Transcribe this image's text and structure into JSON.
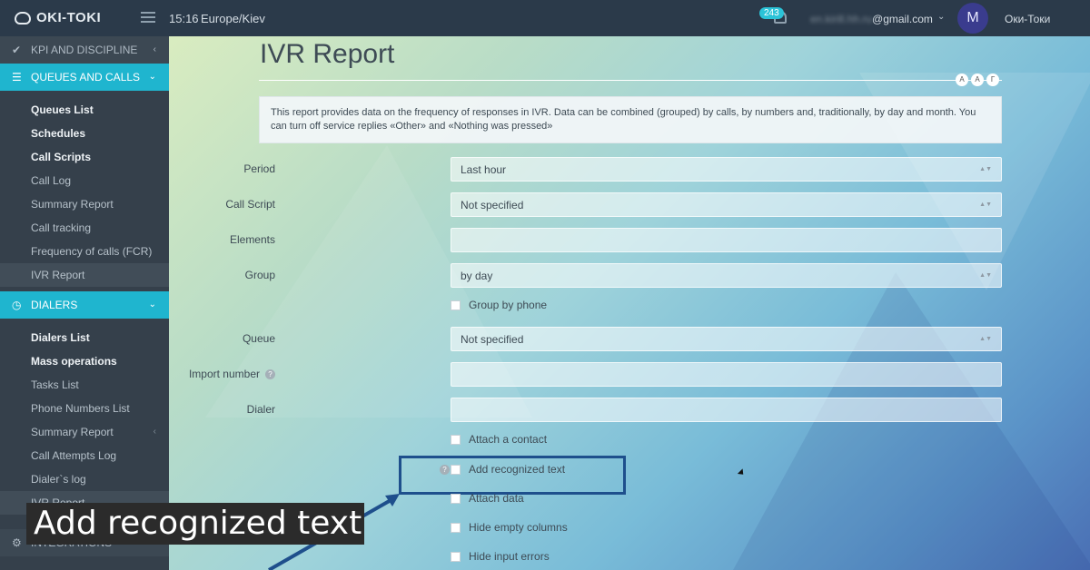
{
  "topbar": {
    "logo": "OKI-TOKI",
    "time": "15:16",
    "timezone": "Europe/Kiev",
    "notification_count": "243",
    "email_hidden": "en.kirill.hh.ru",
    "email_domain": "@gmail.com",
    "avatar_letter": "M",
    "username": "Оки-Токи"
  },
  "sidebar": {
    "kpi": "KPI AND DISCIPLINE",
    "queues": "QUEUES AND CALLS",
    "queue_items": [
      "Queues List",
      "Schedules",
      "Call Scripts",
      "Call Log",
      "Summary Report",
      "Call tracking",
      "Frequency of calls (FCR)",
      "IVR Report"
    ],
    "dialers": "DIALERS",
    "dialer_items": [
      "Dialers List",
      "Mass operations",
      "Tasks List",
      "Phone Numbers List",
      "Summary Report",
      "Call Attempts Log",
      "Dialer`s log",
      "IVR Report"
    ],
    "integrations": "INTEGRATIONS"
  },
  "main": {
    "title": "IVR Report",
    "font_buttons": [
      "A",
      "A",
      "Г"
    ],
    "info": "This report provides data on the frequency of responses in IVR. Data can be combined (grouped) by calls, by numbers and, traditionally, by day and month. You can turn off service replies «Other» and «Nothing was pressed»",
    "fields": {
      "period_label": "Period",
      "period_value": "Last hour",
      "script_label": "Call Script",
      "script_value": "Not specified",
      "elements_label": "Elements",
      "group_label": "Group",
      "group_value": "by day",
      "group_by_phone": "Group by phone",
      "queue_label": "Queue",
      "queue_value": "Not specified",
      "import_label": "Import number",
      "dialer_label": "Dialer"
    },
    "checks": [
      "Attach a contact",
      "Add recognized text",
      "Attach data",
      "Hide empty columns",
      "Hide input errors"
    ]
  },
  "overlay": {
    "caption": "Add recognized text"
  }
}
